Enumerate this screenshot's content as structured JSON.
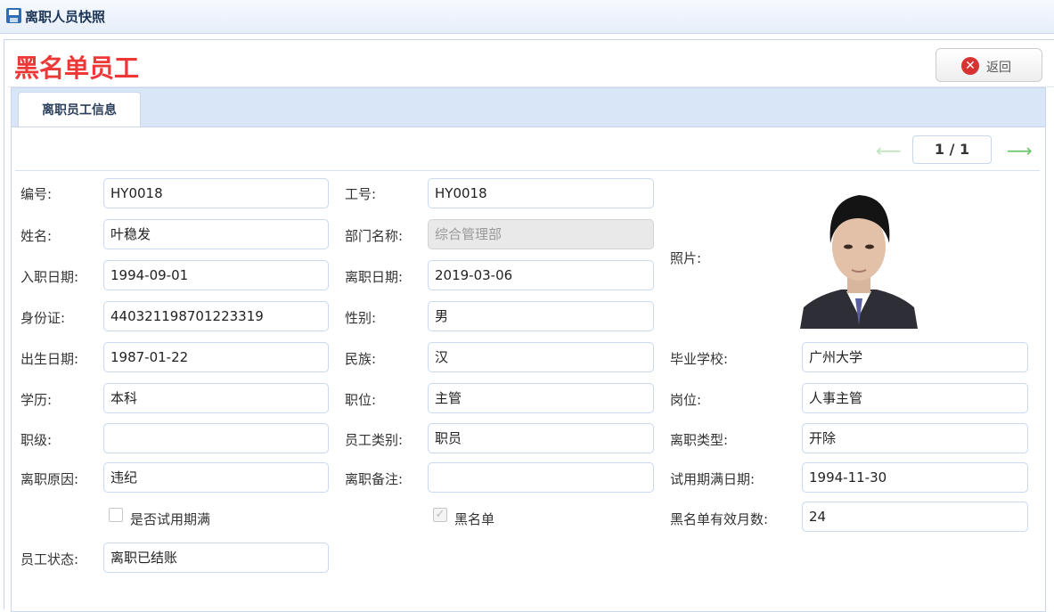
{
  "window": {
    "title": "离职人员快照",
    "icon": "save-icon"
  },
  "page": {
    "title": "黑名单员工",
    "return_label": "返回",
    "return_icon": "close-circle-icon"
  },
  "tabs": [
    {
      "label": "离职员工信息",
      "active": true
    }
  ],
  "pager": {
    "text": "1 / 1",
    "prev_icon": "arrow-left-icon",
    "next_icon": "arrow-right-icon"
  },
  "form": {
    "code_label": "编号:",
    "code_value": "HY0018",
    "emp_no_label": "工号:",
    "emp_no_value": "HY0018",
    "name_label": "姓名:",
    "name_value": "叶稳发",
    "dept_label": "部门名称:",
    "dept_value": "综合管理部",
    "hire_date_label": "入职日期:",
    "hire_date_value": "1994-09-01",
    "leave_date_label": "离职日期:",
    "leave_date_value": "2019-03-06",
    "photo_label": "照片:",
    "id_card_label": "身份证:",
    "id_card_value": "440321198701223319",
    "gender_label": "性别:",
    "gender_value": "男",
    "birth_label": "出生日期:",
    "birth_value": "1987-01-22",
    "ethnic_label": "民族:",
    "ethnic_value": "汉",
    "school_label": "毕业学校:",
    "school_value": "广州大学",
    "edu_label": "学历:",
    "edu_value": "本科",
    "position_label": "职位:",
    "position_value": "主管",
    "post_label": "岗位:",
    "post_value": "人事主管",
    "level_label": "职级:",
    "level_value": "",
    "emp_type_label": "员工类别:",
    "emp_type_value": "职员",
    "leave_type_label": "离职类型:",
    "leave_type_value": "开除",
    "leave_reason_label": "离职原因:",
    "leave_reason_value": "违纪",
    "leave_note_label": "离职备注:",
    "leave_note_value": "",
    "probation_end_label": "试用期满日期:",
    "probation_end_value": "1994-11-30",
    "probation_check_label": "是否试用期满",
    "probation_checked": false,
    "blacklist_check_label": "黑名单",
    "blacklist_checked": true,
    "blacklist_months_label": "黑名单有效月数:",
    "blacklist_months_value": "24",
    "status_label": "员工状态:",
    "status_value": "离职已结账"
  }
}
